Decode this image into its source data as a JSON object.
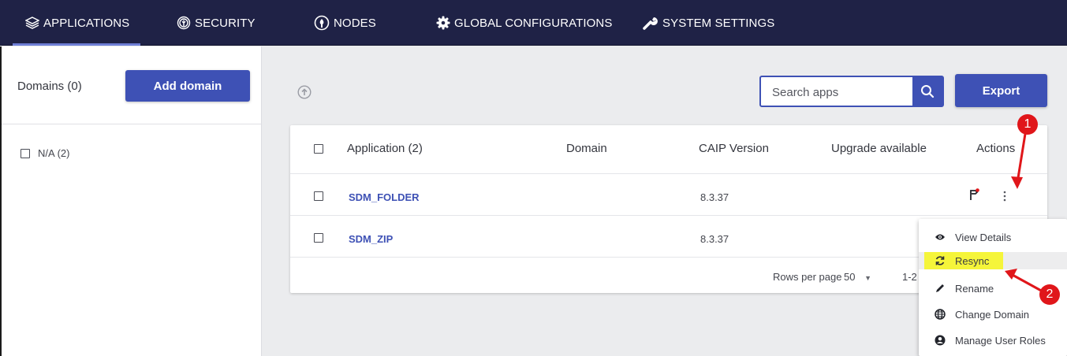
{
  "nav": {
    "items": [
      {
        "label": "APPLICATIONS",
        "icon": "layers-icon",
        "active": true
      },
      {
        "label": "SECURITY",
        "icon": "fingerprint-icon",
        "active": false
      },
      {
        "label": "NODES",
        "icon": "node-icon",
        "active": false
      },
      {
        "label": "GLOBAL CONFIGURATIONS",
        "icon": "gear-icon",
        "active": false
      },
      {
        "label": "SYSTEM SETTINGS",
        "icon": "wrench-icon",
        "active": false
      }
    ],
    "background": "#1f2246",
    "active_indicator": "#6f7fd6"
  },
  "sidebar": {
    "domains_title": "Domains (0)",
    "add_domain_label": "Add domain",
    "items": [
      {
        "label": "N/A (2)",
        "checked": false
      }
    ]
  },
  "toolbar": {
    "search_placeholder": "Search apps",
    "export_label": "Export",
    "accent": "#3e51b5"
  },
  "table": {
    "headers": {
      "application": "Application (2)",
      "domain": "Domain",
      "caip_version": "CAIP Version",
      "upgrade": "Upgrade available",
      "actions": "Actions"
    },
    "rows": [
      {
        "name": "SDM_FOLDER",
        "domain": "",
        "version": "8.3.37",
        "upgrade": ""
      },
      {
        "name": "SDM_ZIP",
        "domain": "",
        "version": "8.3.37",
        "upgrade": ""
      }
    ],
    "pagination": {
      "rows_per_page_label": "Rows per page",
      "rows_per_page_value": "50",
      "range": "1-2"
    }
  },
  "context_menu": {
    "items": [
      {
        "label": "View Details",
        "icon": "eye-icon"
      },
      {
        "label": "Resync",
        "icon": "sync-icon",
        "highlighted": true
      },
      {
        "label": "Rename",
        "icon": "pencil-icon"
      },
      {
        "label": "Change Domain",
        "icon": "globe-icon"
      },
      {
        "label": "Manage User Roles",
        "icon": "user-circle-icon"
      }
    ]
  },
  "annotations": {
    "badges": [
      "1",
      "2"
    ],
    "color": "#e0161a"
  }
}
